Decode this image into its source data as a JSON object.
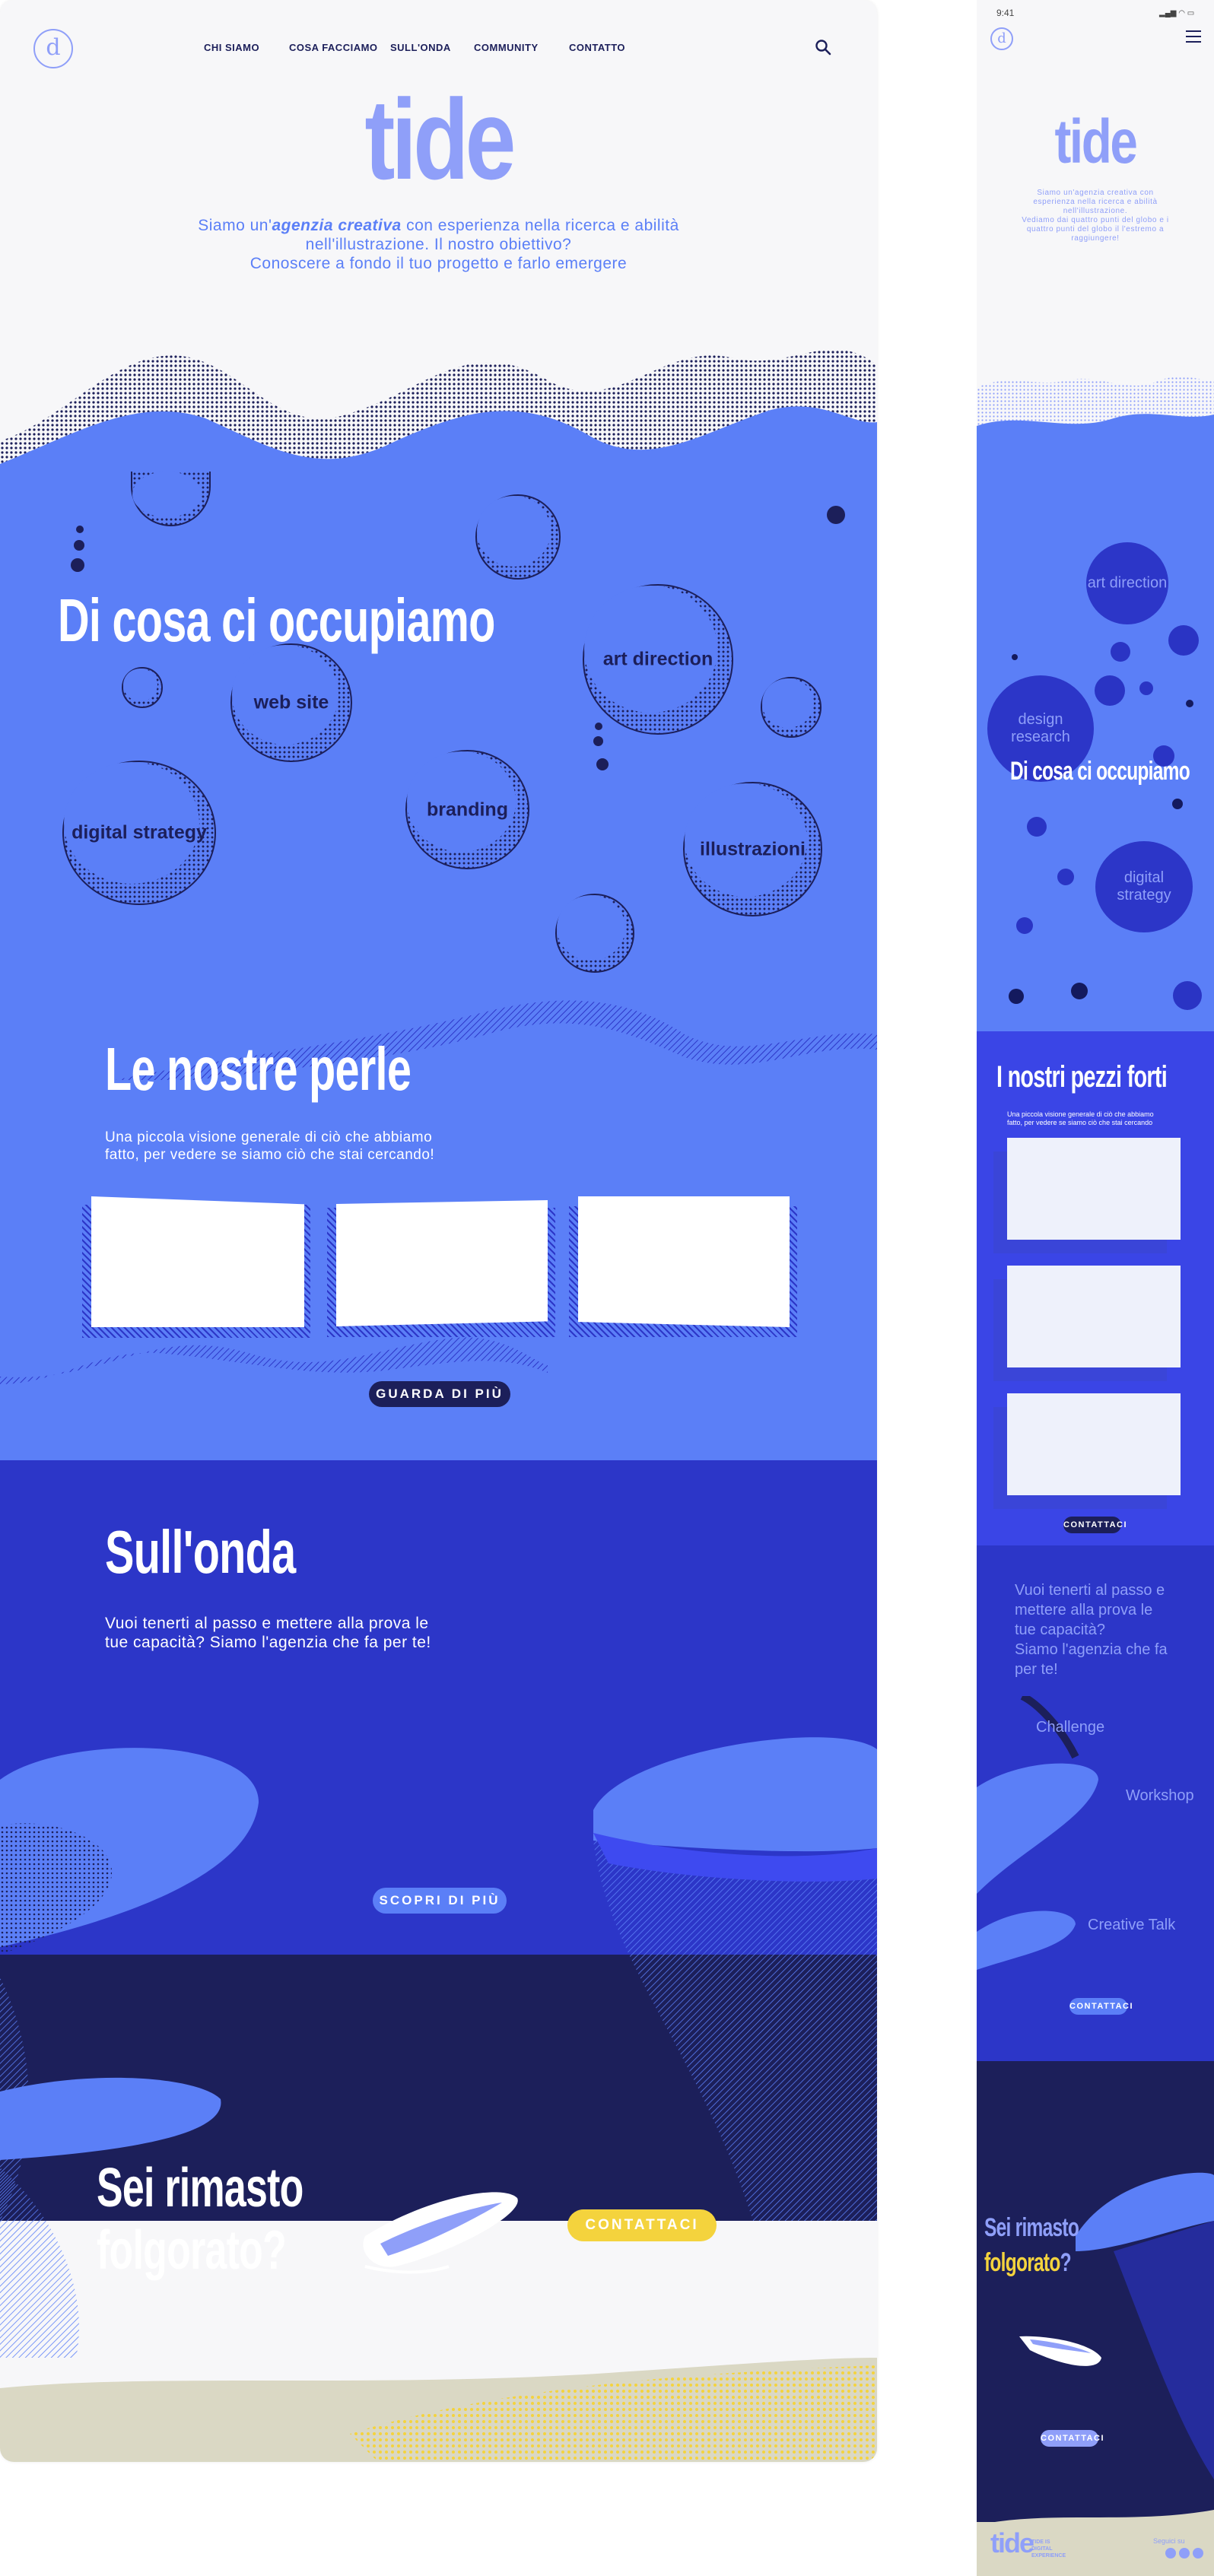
{
  "nav": {
    "items": [
      "CHI SIAMO",
      "COSA FACCIAMO",
      "SULL'ONDA",
      "COMMUNITY",
      "CONTATTO"
    ]
  },
  "brand": {
    "logo_text": "tide",
    "mark": "d"
  },
  "hero": {
    "line1_pre": "Siamo un'",
    "line1_em": "agenzia creativa",
    "line1_post": " con esperienza nella ricerca e abilità",
    "line2": "nell'illustrazione. Il nostro obiettivo?",
    "line3": "Conoscere a fondo il tuo progetto e farlo emergere"
  },
  "services": {
    "title": "Di cosa ci occupiamo",
    "bubbles": [
      "art direction",
      "web site",
      "branding",
      "digital strategy",
      "illustrazioni"
    ]
  },
  "portfolio": {
    "title": "Le nostre perle",
    "line1": "Una piccola visione generale di ciò che abbiamo",
    "line2": "fatto, per vedere se siamo ciò che stai cercando!",
    "button": "GUARDA DI PIÙ"
  },
  "wave_section": {
    "title": "Sull'onda",
    "line1": "Vuoi tenerti al passo e mettere alla prova le",
    "line2": "tue capacità? Siamo l'agenzia che fa per te!",
    "button": "SCOPRI DI PIÙ"
  },
  "cta": {
    "line1": "Sei rimasto",
    "line2": "folgorato?",
    "button": "CONTATTACI"
  },
  "mobile": {
    "status_time": "9:41",
    "hero": {
      "l1": "Siamo un'agenzia creativa con",
      "l2": "esperienza nella ricerca e abilità",
      "l3": "nell'illustrazione.",
      "l4": "Vediamo dai quattro punti del globo e i",
      "l5": "quattro punti del globo il l'estremo a",
      "l6": "raggiungere!"
    },
    "services": {
      "title": "Di cosa ci occupiamo",
      "bubbles": [
        "art direction",
        "design research",
        "digital strategy"
      ]
    },
    "forti": {
      "title": "I nostri pezzi forti",
      "line1": "Una piccola visione generale di ciò che abbiamo",
      "line2": "fatto, per vedere se siamo ciò che stai cercando",
      "button": "CONTATTACI"
    },
    "onda": {
      "l1": "Vuoi tenerti al passo e",
      "l2": "mettere alla prova le",
      "l3": "tue capacità?",
      "l4": "Siamo l'agenzia che fa",
      "l5": "per te!",
      "labels": [
        "Challenge",
        "Workshop",
        "Creative Talk"
      ],
      "button": "CONTATTACI"
    },
    "cta": {
      "line1": "Sei rimasto",
      "line2": "folgorato",
      "q": "?",
      "button": "CONTATTACI"
    },
    "footer": {
      "logo": "tide",
      "tag1": "TIDE IS",
      "tag2": "DIGITAL",
      "tag3": "EXPERIENCE",
      "follow": "Seguici su"
    }
  },
  "colors": {
    "bg_light": "#f7f7f9",
    "blue": "#5b7ff7",
    "royal": "#2c36c8",
    "navy": "#1c1f5a",
    "yellow": "#f4d33d",
    "sand": "#dad8c4",
    "periwinkle": "#8f9ff9"
  }
}
